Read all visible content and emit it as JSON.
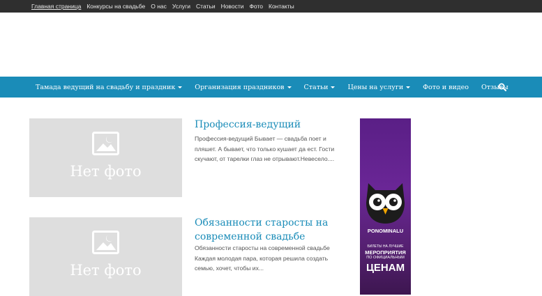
{
  "topbar": {
    "links": [
      "Главная страница",
      "Конкурсы на свадьбе",
      "О нас",
      "Услуги",
      "Статьи",
      "Новости",
      "Фото",
      "Контакты"
    ]
  },
  "nav": {
    "items": [
      {
        "label": "Тамада ведущий на свадьбу и праздник",
        "dropdown": true
      },
      {
        "label": "Организация праздников",
        "dropdown": true
      },
      {
        "label": "Статьи",
        "dropdown": true
      },
      {
        "label": "Цены на услуги",
        "dropdown": true
      },
      {
        "label": "Фото и видео",
        "dropdown": false
      },
      {
        "label": "Отзывы",
        "dropdown": false
      }
    ],
    "search_icon": "search-icon"
  },
  "posts": [
    {
      "thumb_label": "Нет фото",
      "title": "Профессия-ведущий",
      "excerpt": "Профессия-ведущий Бывает — свадьба поет и пляшет. А бывает, что только кушает да ест. Гости скучают, от тарелки глаз не отрывают.Невесело...."
    },
    {
      "thumb_label": "Нет фото",
      "title": "Обязанности старосты на современной свадьбе",
      "excerpt": "Обязанности старосты на современной свадьбе Каждая молодая пара, которая решила создать семью, хочет, чтобы их..."
    }
  ],
  "banner": {
    "brand": "PONOMINALU",
    "line1": "БИЛЕТЫ НА ЛУЧШИЕ",
    "line2": "МЕРОПРИЯТИЯ",
    "line3": "ПО ОФИЦИАЛЬНЫМ",
    "line4": "ЦЕНАМ"
  },
  "colors": {
    "topbar": "#2f2f2f",
    "nav": "#1a8cb8",
    "title": "#1a8cb8",
    "placeholder": "#dedede",
    "banner": "#5a1f86"
  }
}
